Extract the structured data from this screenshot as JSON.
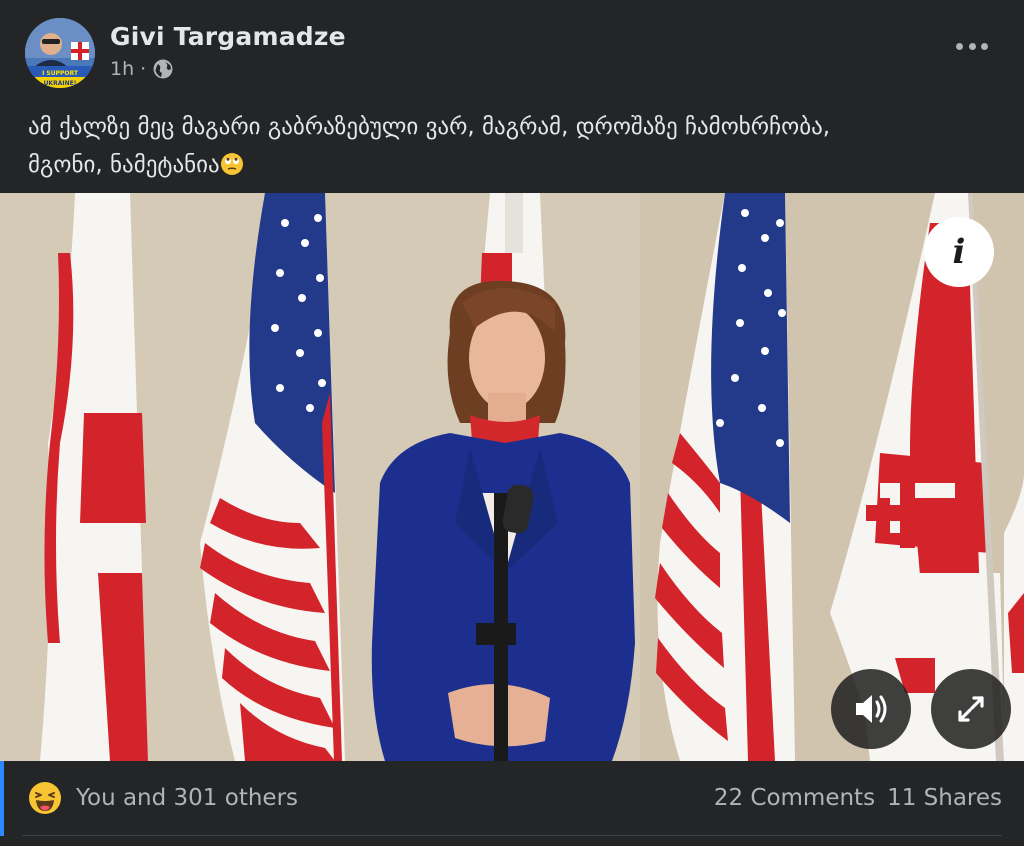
{
  "post": {
    "author": "Givi Targamadze",
    "time": "1h",
    "separator": "·",
    "privacy_icon": "globe-icon",
    "more_icon": "more-options-icon",
    "avatar_badge": "I SUPPORT UKRAINE!",
    "text_line1": "ამ ქალზე მეც მაგარი გაბრაზებული ვარ, მაგრამ, დროშაზე ჩამოხრჩობა,",
    "text_line2": "მგონი, ნამეტანია",
    "text_emoji": "face-with-rolling-eyes-emoji"
  },
  "media": {
    "info_label": "i",
    "sound_icon": "speaker-icon",
    "expand_icon": "expand-icon"
  },
  "footer": {
    "reaction_icon": "haha-reaction-icon",
    "reactions": "You and 301 others",
    "comments": "22 Comments",
    "shares": "11 Shares"
  },
  "colors": {
    "background": "#242526",
    "primary_text": "#e4e6eb",
    "secondary_text": "#b0b3b8",
    "accent": "#2d88ff",
    "flag_red": "#d3242b",
    "flag_blue": "#233a8a",
    "jacket_blue": "#1c2f8f"
  }
}
